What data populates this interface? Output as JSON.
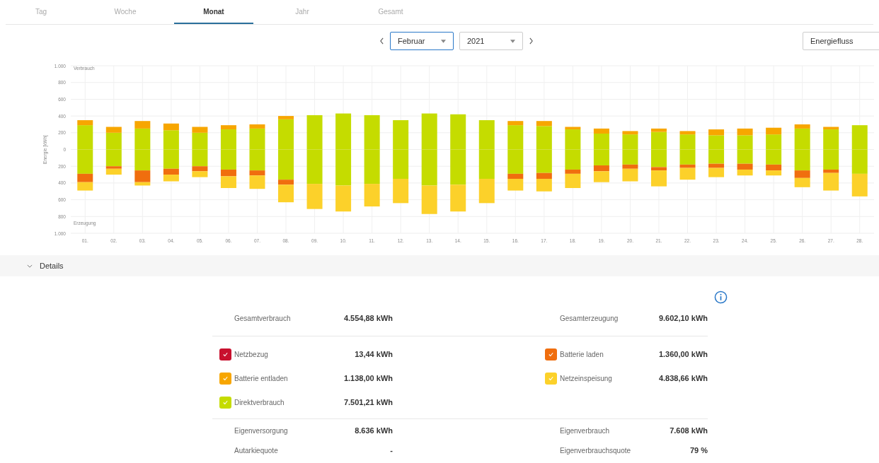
{
  "tabs": [
    {
      "label": "Tag",
      "selected": false
    },
    {
      "label": "Woche",
      "selected": false
    },
    {
      "label": "Monat",
      "selected": true
    },
    {
      "label": "Jahr",
      "selected": false
    },
    {
      "label": "Gesamt",
      "selected": false
    }
  ],
  "period": {
    "month": "Februar",
    "year": "2021"
  },
  "view_select": {
    "value": "Energiefluss"
  },
  "chart": {
    "chart_data": {
      "type": "bar",
      "stacked": true,
      "ylabel": "Energie [kWh]",
      "ylim": [
        -1000,
        1000
      ],
      "yticks": [
        {
          "value": 1000,
          "label": "1.000"
        },
        {
          "value": 800,
          "label": "800"
        },
        {
          "value": 600,
          "label": "600"
        },
        {
          "value": 400,
          "label": "400"
        },
        {
          "value": 200,
          "label": "200"
        },
        {
          "value": 0,
          "label": "0"
        },
        {
          "value": -200,
          "label": "200"
        },
        {
          "value": -400,
          "label": "400"
        },
        {
          "value": -600,
          "label": "600"
        },
        {
          "value": -800,
          "label": "800"
        },
        {
          "value": -1000,
          "label": "1.000"
        }
      ],
      "grid": true,
      "annotations": [
        "Verbrauch",
        "Erzeugung"
      ],
      "categories": [
        "01.",
        "02.",
        "03.",
        "04.",
        "05.",
        "06.",
        "07.",
        "08.",
        "09.",
        "10.",
        "11.",
        "12.",
        "13.",
        "14.",
        "15.",
        "16.",
        "17.",
        "18.",
        "19.",
        "20.",
        "21.",
        "22.",
        "23.",
        "24.",
        "25.",
        "26.",
        "27.",
        "28."
      ],
      "series": [
        {
          "color": "#c5dc00",
          "values": [
            290,
            200,
            250,
            230,
            200,
            240,
            250,
            360,
            410,
            430,
            410,
            350,
            430,
            420,
            350,
            290,
            280,
            240,
            190,
            180,
            210,
            180,
            170,
            170,
            180,
            250,
            240,
            290
          ]
        },
        {
          "color": "#f7a600",
          "values": [
            60,
            70,
            90,
            80,
            70,
            50,
            50,
            40,
            0,
            0,
            0,
            0,
            0,
            0,
            0,
            50,
            60,
            30,
            60,
            40,
            40,
            40,
            70,
            80,
            80,
            50,
            30,
            0
          ]
        },
        {
          "color": "#c5dc00",
          "values": [
            -290,
            -200,
            -250,
            -230,
            -200,
            -240,
            -250,
            -360,
            -410,
            -430,
            -410,
            -350,
            -430,
            -420,
            -350,
            -290,
            -280,
            -240,
            -190,
            -180,
            -210,
            -180,
            -170,
            -170,
            -180,
            -250,
            -240,
            -290
          ]
        },
        {
          "color": "#f06e0e",
          "values": [
            -100,
            -30,
            -140,
            -70,
            -60,
            -80,
            -60,
            -60,
            0,
            0,
            0,
            0,
            0,
            0,
            0,
            -60,
            -70,
            -50,
            -70,
            -50,
            -40,
            -40,
            -50,
            -70,
            -70,
            -90,
            -40,
            0
          ]
        },
        {
          "color": "#fcd12a",
          "values": [
            -100,
            -70,
            -40,
            -80,
            -70,
            -140,
            -160,
            -210,
            -300,
            -310,
            -270,
            -290,
            -340,
            -320,
            -290,
            -140,
            -150,
            -170,
            -130,
            -150,
            -190,
            -140,
            -110,
            -70,
            -60,
            -110,
            -210,
            -270
          ]
        }
      ]
    }
  },
  "details": {
    "title": "Details",
    "expanded": true,
    "sections": [
      {
        "kind": "totals",
        "left": [
          {
            "label": "Gesamtverbrauch",
            "value": "4.554,88 kWh"
          }
        ],
        "right": [
          {
            "label": "Gesamterzeugung",
            "value": "9.602,10 kWh"
          }
        ]
      },
      {
        "kind": "legend",
        "left": [
          {
            "label": "Netzbezug",
            "value": "13,44 kWh",
            "color": "#c8102e",
            "checked": true
          },
          {
            "label": "Batterie entladen",
            "value": "1.138,00 kWh",
            "color": "#f7a600",
            "checked": true
          },
          {
            "label": "Direktverbrauch",
            "value": "7.501,21 kWh",
            "color": "#c5dc00",
            "checked": true
          }
        ],
        "right": [
          {
            "label": "Batterie laden",
            "value": "1.360,00 kWh",
            "color": "#f06e0e",
            "checked": true
          },
          {
            "label": "Netzeinspeisung",
            "value": "4.838,66 kWh",
            "color": "#fcd12a",
            "checked": true
          }
        ]
      },
      {
        "kind": "ratios",
        "left": [
          {
            "label": "Eigenversorgung",
            "value": "8.636 kWh"
          },
          {
            "label": "Autarkiequote",
            "value": "-"
          }
        ],
        "right": [
          {
            "label": "Eigenverbrauch",
            "value": "7.608 kWh"
          },
          {
            "label": "Eigenverbrauchsquote",
            "value": "79 %"
          }
        ]
      }
    ]
  }
}
